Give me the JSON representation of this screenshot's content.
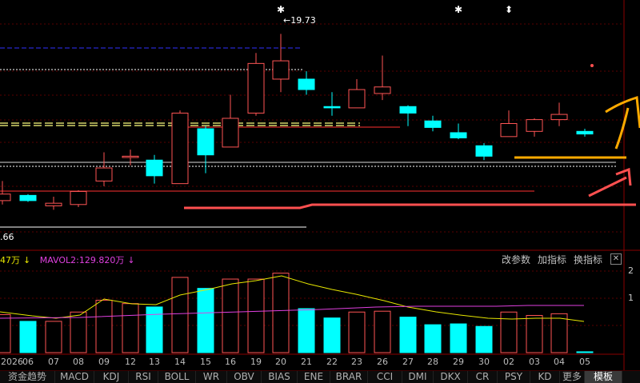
{
  "chart_data": {
    "type": "candlestick",
    "title": "",
    "price_ylim": [
      12.0,
      20.6
    ],
    "candles": [
      {
        "date": "05",
        "open": 13.6,
        "close": 13.35,
        "high": 14.1,
        "low": 13.2,
        "color": "up"
      },
      {
        "date": "06",
        "open": 13.35,
        "close": 13.55,
        "high": 13.6,
        "low": 13.3,
        "color": "down"
      },
      {
        "date": "07",
        "open": 13.15,
        "close": 13.25,
        "high": 13.5,
        "low": 13.0,
        "color": "up"
      },
      {
        "date": "08",
        "open": 13.2,
        "close": 13.7,
        "high": 13.75,
        "low": 13.1,
        "color": "up"
      },
      {
        "date": "09",
        "open": 14.1,
        "close": 14.6,
        "high": 15.2,
        "low": 13.9,
        "color": "up"
      },
      {
        "date": "12",
        "open": 15.0,
        "close": 15.05,
        "high": 15.3,
        "low": 14.7,
        "color": "up"
      },
      {
        "date": "13",
        "open": 14.9,
        "close": 14.3,
        "high": 15.1,
        "low": 14.0,
        "color": "down"
      },
      {
        "date": "14",
        "open": 14.0,
        "close": 16.7,
        "high": 16.8,
        "low": 14.0,
        "color": "up"
      },
      {
        "date": "15",
        "open": 16.1,
        "close": 15.1,
        "high": 16.2,
        "low": 14.4,
        "color": "down"
      },
      {
        "date": "16",
        "open": 15.4,
        "close": 16.5,
        "high": 17.4,
        "low": 16.5,
        "color": "up"
      },
      {
        "date": "19",
        "open": 16.7,
        "close": 18.6,
        "high": 19.0,
        "low": 16.6,
        "color": "up"
      },
      {
        "date": "20",
        "open": 18.0,
        "close": 18.7,
        "high": 19.73,
        "low": 17.5,
        "color": "up"
      },
      {
        "date": "21",
        "open": 18.0,
        "close": 17.6,
        "high": 18.3,
        "low": 17.4,
        "color": "down"
      },
      {
        "date": "22",
        "open": 16.9,
        "close": 16.95,
        "high": 17.5,
        "low": 16.6,
        "color": "down"
      },
      {
        "date": "23",
        "open": 16.9,
        "close": 17.6,
        "high": 18.0,
        "low": 16.9,
        "color": "up"
      },
      {
        "date": "26",
        "open": 17.45,
        "close": 17.7,
        "high": 18.9,
        "low": 17.2,
        "color": "up"
      },
      {
        "date": "27",
        "open": 16.95,
        "close": 16.7,
        "high": 17.0,
        "low": 16.2,
        "color": "down"
      },
      {
        "date": "28",
        "open": 16.4,
        "close": 16.15,
        "high": 16.6,
        "low": 16.0,
        "color": "down"
      },
      {
        "date": "29",
        "open": 15.95,
        "close": 15.75,
        "high": 16.3,
        "low": 15.7,
        "color": "down"
      },
      {
        "date": "30",
        "open": 15.45,
        "close": 15.05,
        "high": 15.55,
        "low": 14.9,
        "color": "down"
      },
      {
        "date": "02",
        "open": 15.8,
        "close": 16.3,
        "high": 16.8,
        "low": 15.8,
        "color": "up"
      },
      {
        "date": "03",
        "open": 16.0,
        "close": 16.45,
        "high": 16.5,
        "low": 15.8,
        "color": "up"
      },
      {
        "date": "04",
        "open": 16.45,
        "close": 16.65,
        "high": 17.1,
        "low": 16.2,
        "color": "up"
      },
      {
        "date": "05",
        "open": 16.0,
        "close": 15.9,
        "high": 16.1,
        "low": 15.8,
        "color": "down"
      }
    ],
    "annotations": {
      "high_label": "←19.73",
      "low_label": ".66"
    },
    "volume": {
      "values": [
        115,
        107,
        107,
        118,
        132,
        128,
        124,
        159,
        146,
        157,
        157,
        164,
        122,
        111,
        118,
        119,
        112,
        103,
        104,
        101,
        118,
        114,
        116,
        71
      ],
      "ylim": [
        70,
        175
      ],
      "axis_ticks": [
        "2",
        "1"
      ],
      "mavol1_label": "47万",
      "mavol2_label": "MAVOL2:129.820万",
      "mavol1_arrow": "↓",
      "mavol2_arrow": "↓"
    }
  },
  "toolbar": {
    "change_params": "改参数",
    "add_indicator": "加指标",
    "switch_indicator": "换指标",
    "close": "✕"
  },
  "date_axis": {
    "year_label": "2026",
    "labels": [
      "06",
      "07",
      "08",
      "09",
      "12",
      "13",
      "14",
      "15",
      "16",
      "19",
      "20",
      "21",
      "22",
      "23",
      "26",
      "27",
      "28",
      "29",
      "30",
      "02",
      "03",
      "04",
      "05"
    ]
  },
  "tabs": [
    "资金趋势",
    "MACD",
    "KDJ",
    "RSI",
    "BOLL",
    "WR",
    "OBV",
    "BIAS",
    "ENE",
    "BRAR",
    "CCI",
    "DMI",
    "DKX",
    "CR",
    "PSY",
    "KD",
    "更多",
    "模板"
  ],
  "active_tab": "模板",
  "markers": [
    "✱",
    "✱",
    "⬍"
  ],
  "colors": {
    "up": "#ff5555",
    "down": "#00ffff",
    "mavol1": "#e6e600",
    "mavol2": "#e040e0",
    "drawing_orange": "#ffaa00",
    "drawing_red": "#ff4444"
  }
}
